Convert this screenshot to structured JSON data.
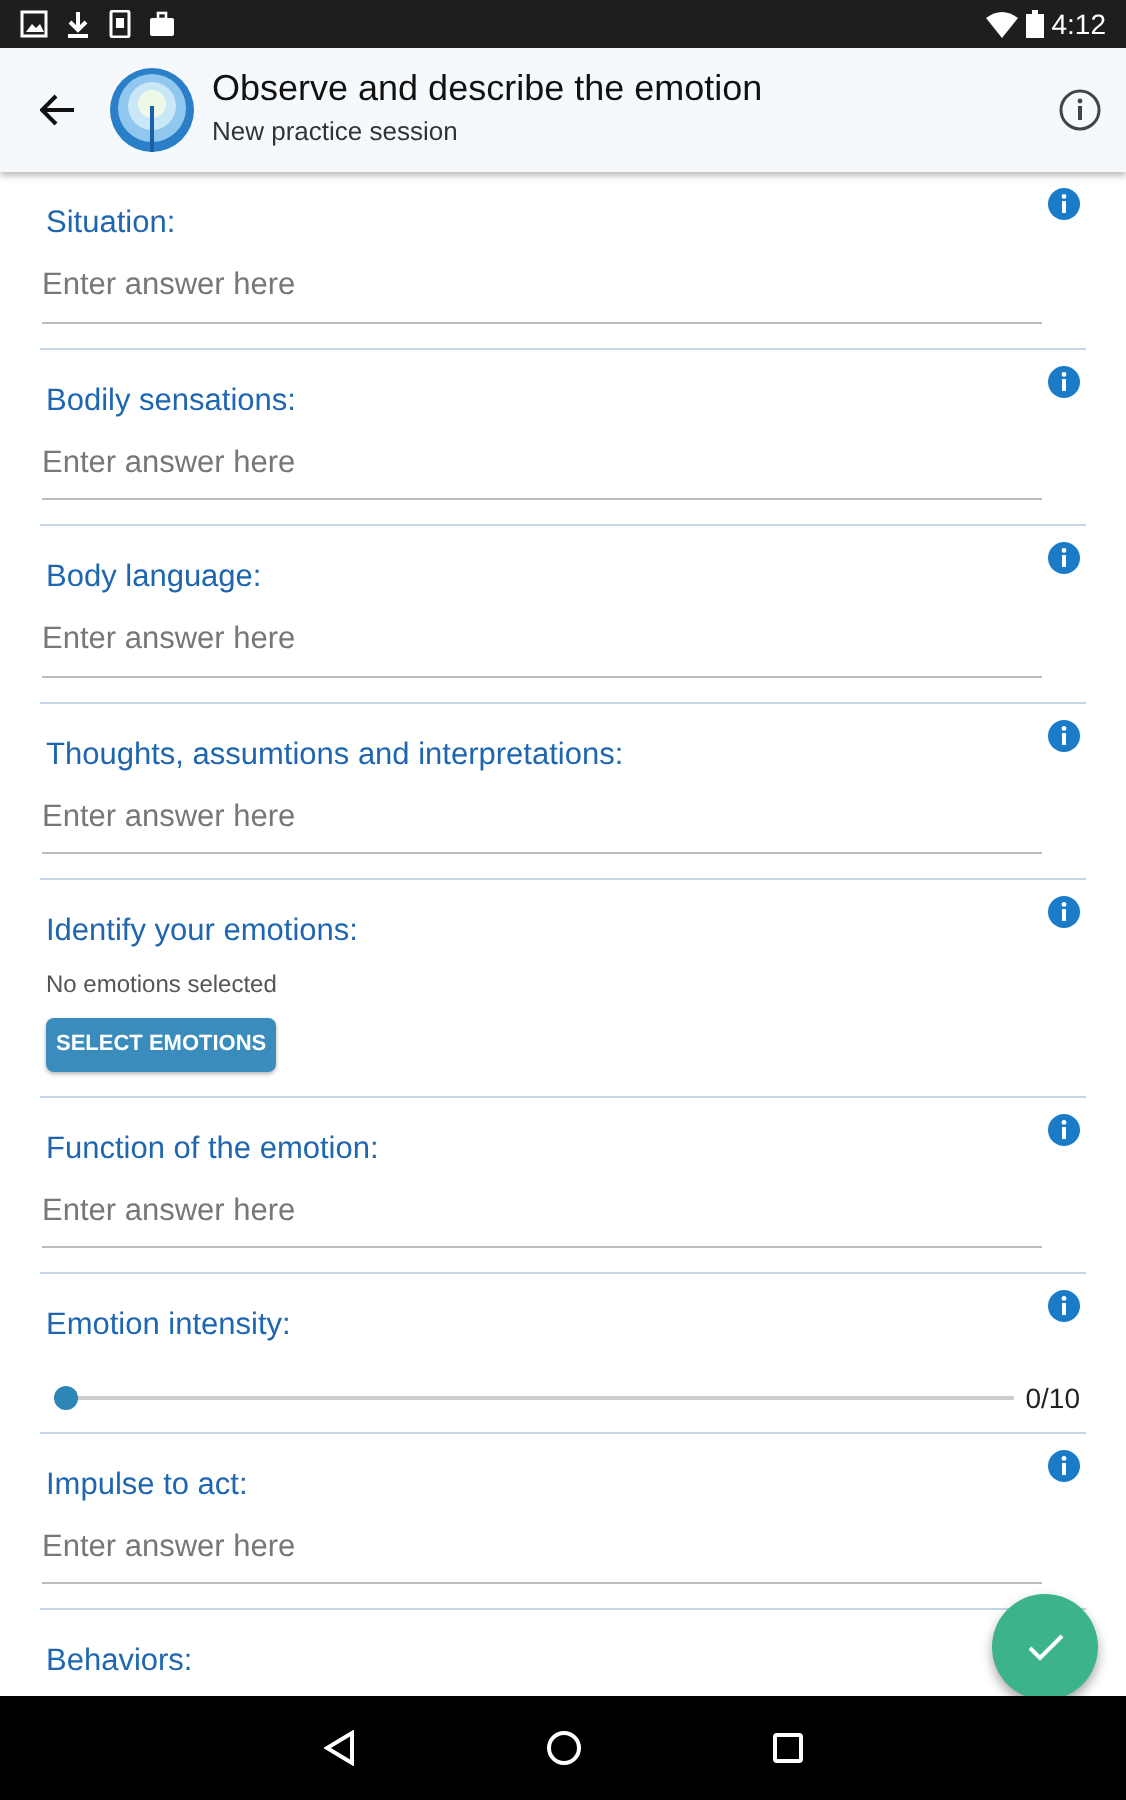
{
  "status_bar": {
    "time": "4:12"
  },
  "app_bar": {
    "title": "Observe and describe the emotion",
    "subtitle": "New practice session"
  },
  "sections": [
    {
      "kind": "text",
      "label": "Situation:",
      "placeholder": "Enter answer here"
    },
    {
      "kind": "text",
      "label": "Bodily sensations:",
      "placeholder": "Enter answer here"
    },
    {
      "kind": "text",
      "label": "Body language:",
      "placeholder": "Enter answer here"
    },
    {
      "kind": "text",
      "label": "Thoughts, assumtions and interpretations:",
      "placeholder": "Enter answer here"
    },
    {
      "kind": "emotions",
      "label": "Identify your emotions:",
      "note": "No emotions selected",
      "button": "SELECT EMOTIONS"
    },
    {
      "kind": "text",
      "label": "Function of the emotion:",
      "placeholder": "Enter answer here"
    },
    {
      "kind": "slider",
      "label": "Emotion intensity:",
      "level": 0,
      "reading": "0/10"
    },
    {
      "kind": "text",
      "label": "Impulse to act:",
      "placeholder": "Enter answer here"
    },
    {
      "kind": "cut",
      "label": "Behaviors:"
    }
  ]
}
